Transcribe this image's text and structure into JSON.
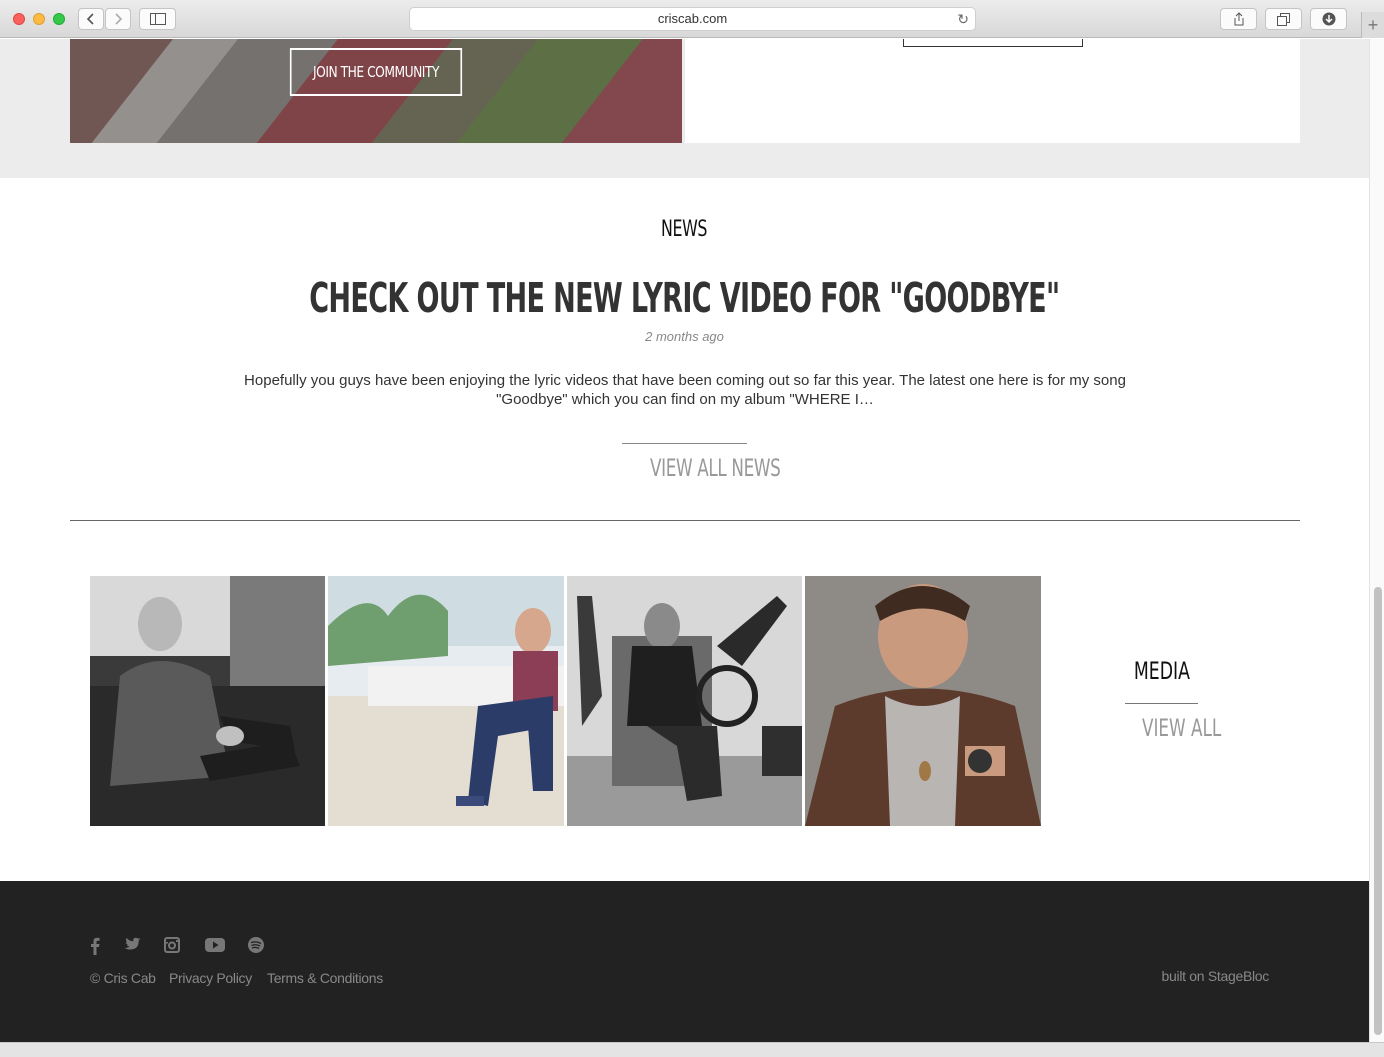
{
  "browser": {
    "url": "criscab.com"
  },
  "promo": {
    "join_label": "JOIN THE COMMUNITY"
  },
  "news": {
    "section_title": "NEWS",
    "headline": "CHECK OUT THE NEW LYRIC VIDEO FOR \"GOODBYE\"",
    "date": "2 months ago",
    "excerpt": "Hopefully you guys have been enjoying the lyric videos that have been coming out so far this year. The latest one here is for my song \"Goodbye\" which you can find on my album \"WHERE I…",
    "view_all_label": "VIEW ALL NEWS"
  },
  "media": {
    "title": "MEDIA",
    "view_all_label": "VIEW ALL",
    "photos": [
      "photo-bw-couch",
      "photo-color-steps",
      "photo-bw-motorcycle",
      "photo-color-leather-jacket"
    ]
  },
  "footer": {
    "social_icons": [
      "facebook-icon",
      "twitter-icon",
      "instagram-icon",
      "youtube-icon",
      "spotify-icon"
    ],
    "copyright": "© Cris Cab",
    "privacy": "Privacy Policy",
    "terms": "Terms & Conditions",
    "built_on": "built on StageBloc"
  },
  "colors": {
    "footer_bg": "#222222",
    "band_bg": "#ececec",
    "muted_text": "#999999"
  }
}
